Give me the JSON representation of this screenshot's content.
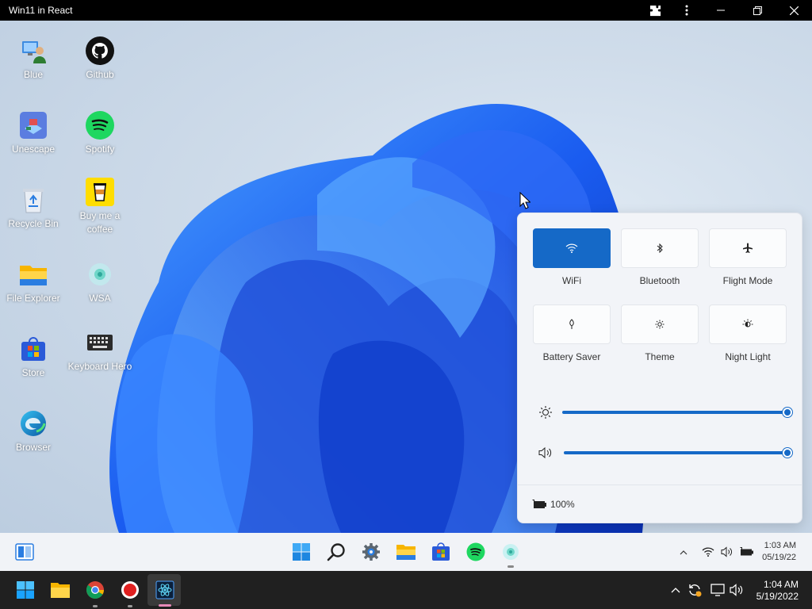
{
  "window": {
    "title": "Win11 in React"
  },
  "desktop_icons": [
    {
      "label": "Blue",
      "icon": "user-pc-icon"
    },
    {
      "label": "Github",
      "icon": "github-icon"
    },
    {
      "label": "Unescape",
      "icon": "unescape-game-icon"
    },
    {
      "label": "Spotify",
      "icon": "spotify-icon"
    },
    {
      "label": "Recycle Bin",
      "icon": "recycle-bin-icon"
    },
    {
      "label": "Buy me a coffee",
      "icon": "coffee-cup-icon"
    },
    {
      "label": "File Explorer",
      "icon": "folder-icon"
    },
    {
      "label": "WSA",
      "icon": "wsa-icon"
    },
    {
      "label": "Store",
      "icon": "store-icon"
    },
    {
      "label": "Keyboard Hero",
      "icon": "keyboard-icon"
    },
    {
      "label": "Browser",
      "icon": "edge-icon"
    }
  ],
  "quick_settings": {
    "tiles": [
      {
        "label": "WiFi",
        "icon": "wifi-icon",
        "active": true
      },
      {
        "label": "Bluetooth",
        "icon": "bluetooth-icon",
        "active": false
      },
      {
        "label": "Flight Mode",
        "icon": "airplane-icon",
        "active": false
      },
      {
        "label": "Battery Saver",
        "icon": "battery-saver-icon",
        "active": false
      },
      {
        "label": "Theme",
        "icon": "theme-icon",
        "active": false
      },
      {
        "label": "Night Light",
        "icon": "night-light-icon",
        "active": false
      }
    ],
    "brightness": {
      "icon": "brightness-icon",
      "value_percent": 100
    },
    "volume": {
      "icon": "volume-icon",
      "value_percent": 100
    },
    "battery_text": "100%",
    "accent": "#1569c7"
  },
  "taskbar": {
    "apps": [
      "widgets-icon",
      "start-icon",
      "search-icon",
      "settings-icon",
      "file-explorer-icon",
      "store-icon",
      "spotify-icon",
      "wsa-icon"
    ],
    "tray": [
      "chevron-up-icon",
      "wifi-icon",
      "volume-icon",
      "battery-icon"
    ],
    "time": "1:03 AM",
    "date": "05/19/22"
  },
  "host_taskbar": {
    "apps": [
      "windows-start-icon",
      "file-explorer-icon",
      "chrome-icon",
      "record-icon",
      "win11react-app-icon"
    ],
    "tray": [
      "chevron-up-icon",
      "sync-icon",
      "display-icon",
      "volume-icon"
    ],
    "time": "1:04 AM",
    "date": "5/19/2022"
  }
}
